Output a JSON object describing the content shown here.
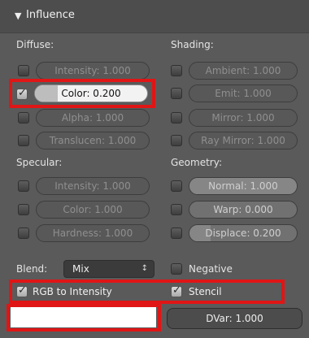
{
  "header": {
    "title": "Influence"
  },
  "diffuse": {
    "label": "Diffuse:",
    "intensity": {
      "label": "Intensity: 1.000",
      "checked": false,
      "active": false
    },
    "color": {
      "label": "Color: 0.200",
      "checked": true,
      "active": true,
      "fill": 0.2
    },
    "alpha": {
      "label": "Alpha: 1.000",
      "checked": false,
      "active": false
    },
    "translucency": {
      "label": "Translucen: 1.000",
      "checked": false,
      "active": false
    }
  },
  "shading": {
    "label": "Shading:",
    "ambient": {
      "label": "Ambient: 1.000",
      "checked": false
    },
    "emit": {
      "label": "Emit: 1.000",
      "checked": false
    },
    "mirror": {
      "label": "Mirror: 1.000",
      "checked": false
    },
    "ray_mirror": {
      "label": "Ray Mirror: 1.000",
      "checked": false
    }
  },
  "specular": {
    "label": "Specular:",
    "intensity": {
      "label": "Intensity: 1.000",
      "checked": false
    },
    "color": {
      "label": "Color: 1.000",
      "checked": false
    },
    "hardness": {
      "label": "Hardness: 1.000",
      "checked": false
    }
  },
  "geometry": {
    "label": "Geometry:",
    "normal": {
      "label": "Normal: 1.000",
      "checked": false,
      "fill": 1.0
    },
    "warp": {
      "label": "Warp: 0.000",
      "checked": false,
      "fill": 0.0
    },
    "displace": {
      "label": "Displace: 0.200",
      "checked": false,
      "fill": 0.2
    }
  },
  "blend": {
    "label": "Blend:",
    "value": "Mix"
  },
  "negative": {
    "label": "Negative",
    "checked": false
  },
  "rgb_to_intensity": {
    "label": "RGB to Intensity",
    "checked": true
  },
  "stencil": {
    "label": "Stencil",
    "checked": true
  },
  "dvar": {
    "label": "DVar: 1.000"
  },
  "colors": {
    "highlight": "#e01515",
    "panel": "#5a5a5a"
  },
  "icons": {
    "collapse": "triangle-down-icon",
    "select": "up-down-arrows-icon",
    "check": "checkmark-icon"
  }
}
